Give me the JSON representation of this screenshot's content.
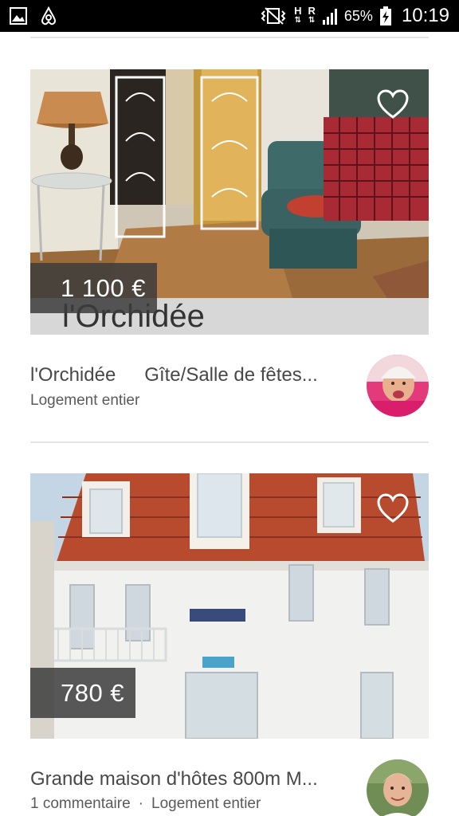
{
  "status_bar": {
    "icons_left": [
      "gallery-icon",
      "airbnb-icon"
    ],
    "icons_right": [
      "vibrate-icon",
      "network-h-icon",
      "network-r-icon",
      "signal-icon",
      "battery-charging-icon"
    ],
    "network_h": "H",
    "network_r": "R",
    "battery": "65%",
    "time": "10:19"
  },
  "listings": [
    {
      "price": "1 100 €",
      "photo_caption": "l'Orchidée",
      "title_name": "l'Orchidée",
      "title_rest": "Gîte/Salle de fêtes...",
      "subtitle_type": "Logement entier",
      "reviews": "",
      "favorite_icon": "heart-outline-icon",
      "avatar": "host-avatar-child"
    },
    {
      "price": "780 €",
      "title": "Grande maison d'hôtes 800m M...",
      "reviews": "1 commentaire",
      "separator": "·",
      "subtitle_type": "Logement entier",
      "favorite_icon": "heart-outline-icon",
      "avatar": "host-avatar-man"
    }
  ],
  "colors": {
    "status_bar": "#000000",
    "divider": "#e4e4e4",
    "price_tag": "#3c3c3c",
    "text": "#484848"
  }
}
